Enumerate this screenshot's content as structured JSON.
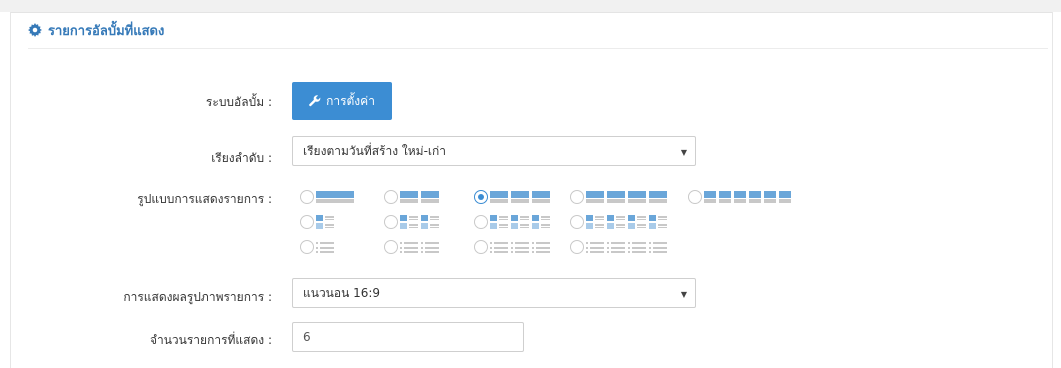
{
  "panel": {
    "title": "รายการอัลบั้มที่แสดง",
    "icon": "gear-icon"
  },
  "fields": {
    "album_system": {
      "label": "ระบบอัลบั้ม :",
      "button_label": "การตั้งค่า",
      "button_icon": "wrench-icon"
    },
    "sort_order": {
      "label": "เรียงลำดับ :",
      "selected": "เรียงตามวันที่สร้าง ใหม่-เก่า"
    },
    "display_layout": {
      "label": "รูปแบบการแสดงรายการ :",
      "options": [
        {
          "style": "wide",
          "cols": 1,
          "selected": false
        },
        {
          "style": "wide",
          "cols": 2,
          "selected": false
        },
        {
          "style": "wide",
          "cols": 3,
          "selected": true
        },
        {
          "style": "wide",
          "cols": 4,
          "selected": false
        },
        {
          "style": "wide",
          "cols": 6,
          "selected": false
        },
        {
          "style": "thumb-list",
          "cols": 1,
          "selected": false
        },
        {
          "style": "thumb-list",
          "cols": 2,
          "selected": false
        },
        {
          "style": "thumb-list",
          "cols": 3,
          "selected": false
        },
        {
          "style": "thumb-list",
          "cols": 4,
          "selected": false
        },
        {
          "style": "text-list",
          "cols": 1,
          "selected": false
        },
        {
          "style": "text-list",
          "cols": 2,
          "selected": false
        },
        {
          "style": "text-list",
          "cols": 3,
          "selected": false
        },
        {
          "style": "text-list",
          "cols": 4,
          "selected": false
        }
      ]
    },
    "image_display": {
      "label": "การแสดงผลรูปภาพรายการ :",
      "selected": "แนวนอน 16:9"
    },
    "item_count": {
      "label": "จำนวนรายการที่แสดง :",
      "value": "6"
    }
  },
  "colors": {
    "accent": "#3c8dd3",
    "title": "#3579b8",
    "thumb_light": "#a9cbe9",
    "thumb_dark": "#6aa6d9",
    "thumb_gray": "#c8c8c8"
  }
}
